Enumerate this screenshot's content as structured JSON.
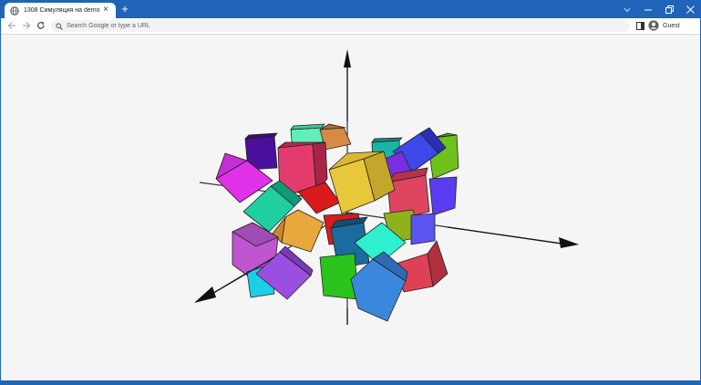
{
  "browser": {
    "tab_title": "1308 Симуляция на demo.html",
    "omnibox_placeholder": "Search Google or type a URL",
    "profile_name": "Guest"
  },
  "colors": {
    "chrome_blue": "#1f64b8",
    "page_background": "#f5f5f5"
  },
  "scene": {
    "description_type": "3D simulation with colored cubes and three arrow axes",
    "cube_colors": [
      "#4b0f9e",
      "#5ef0b8",
      "#d88a45",
      "#c42fd4",
      "#e33c6c",
      "#1bb5a8",
      "#3d48e8",
      "#6fc11c",
      "#e8c83a",
      "#e04560",
      "#5b3cf0",
      "#1fcfa0",
      "#e8a93c",
      "#bf55cf",
      "#d91b1b",
      "#1a6b9e",
      "#2ef0cf",
      "#8fb21c",
      "#9b4fe0",
      "#1bcfe8",
      "#29c41c",
      "#3b87dc",
      "#e04055",
      "#d94aa8"
    ]
  }
}
